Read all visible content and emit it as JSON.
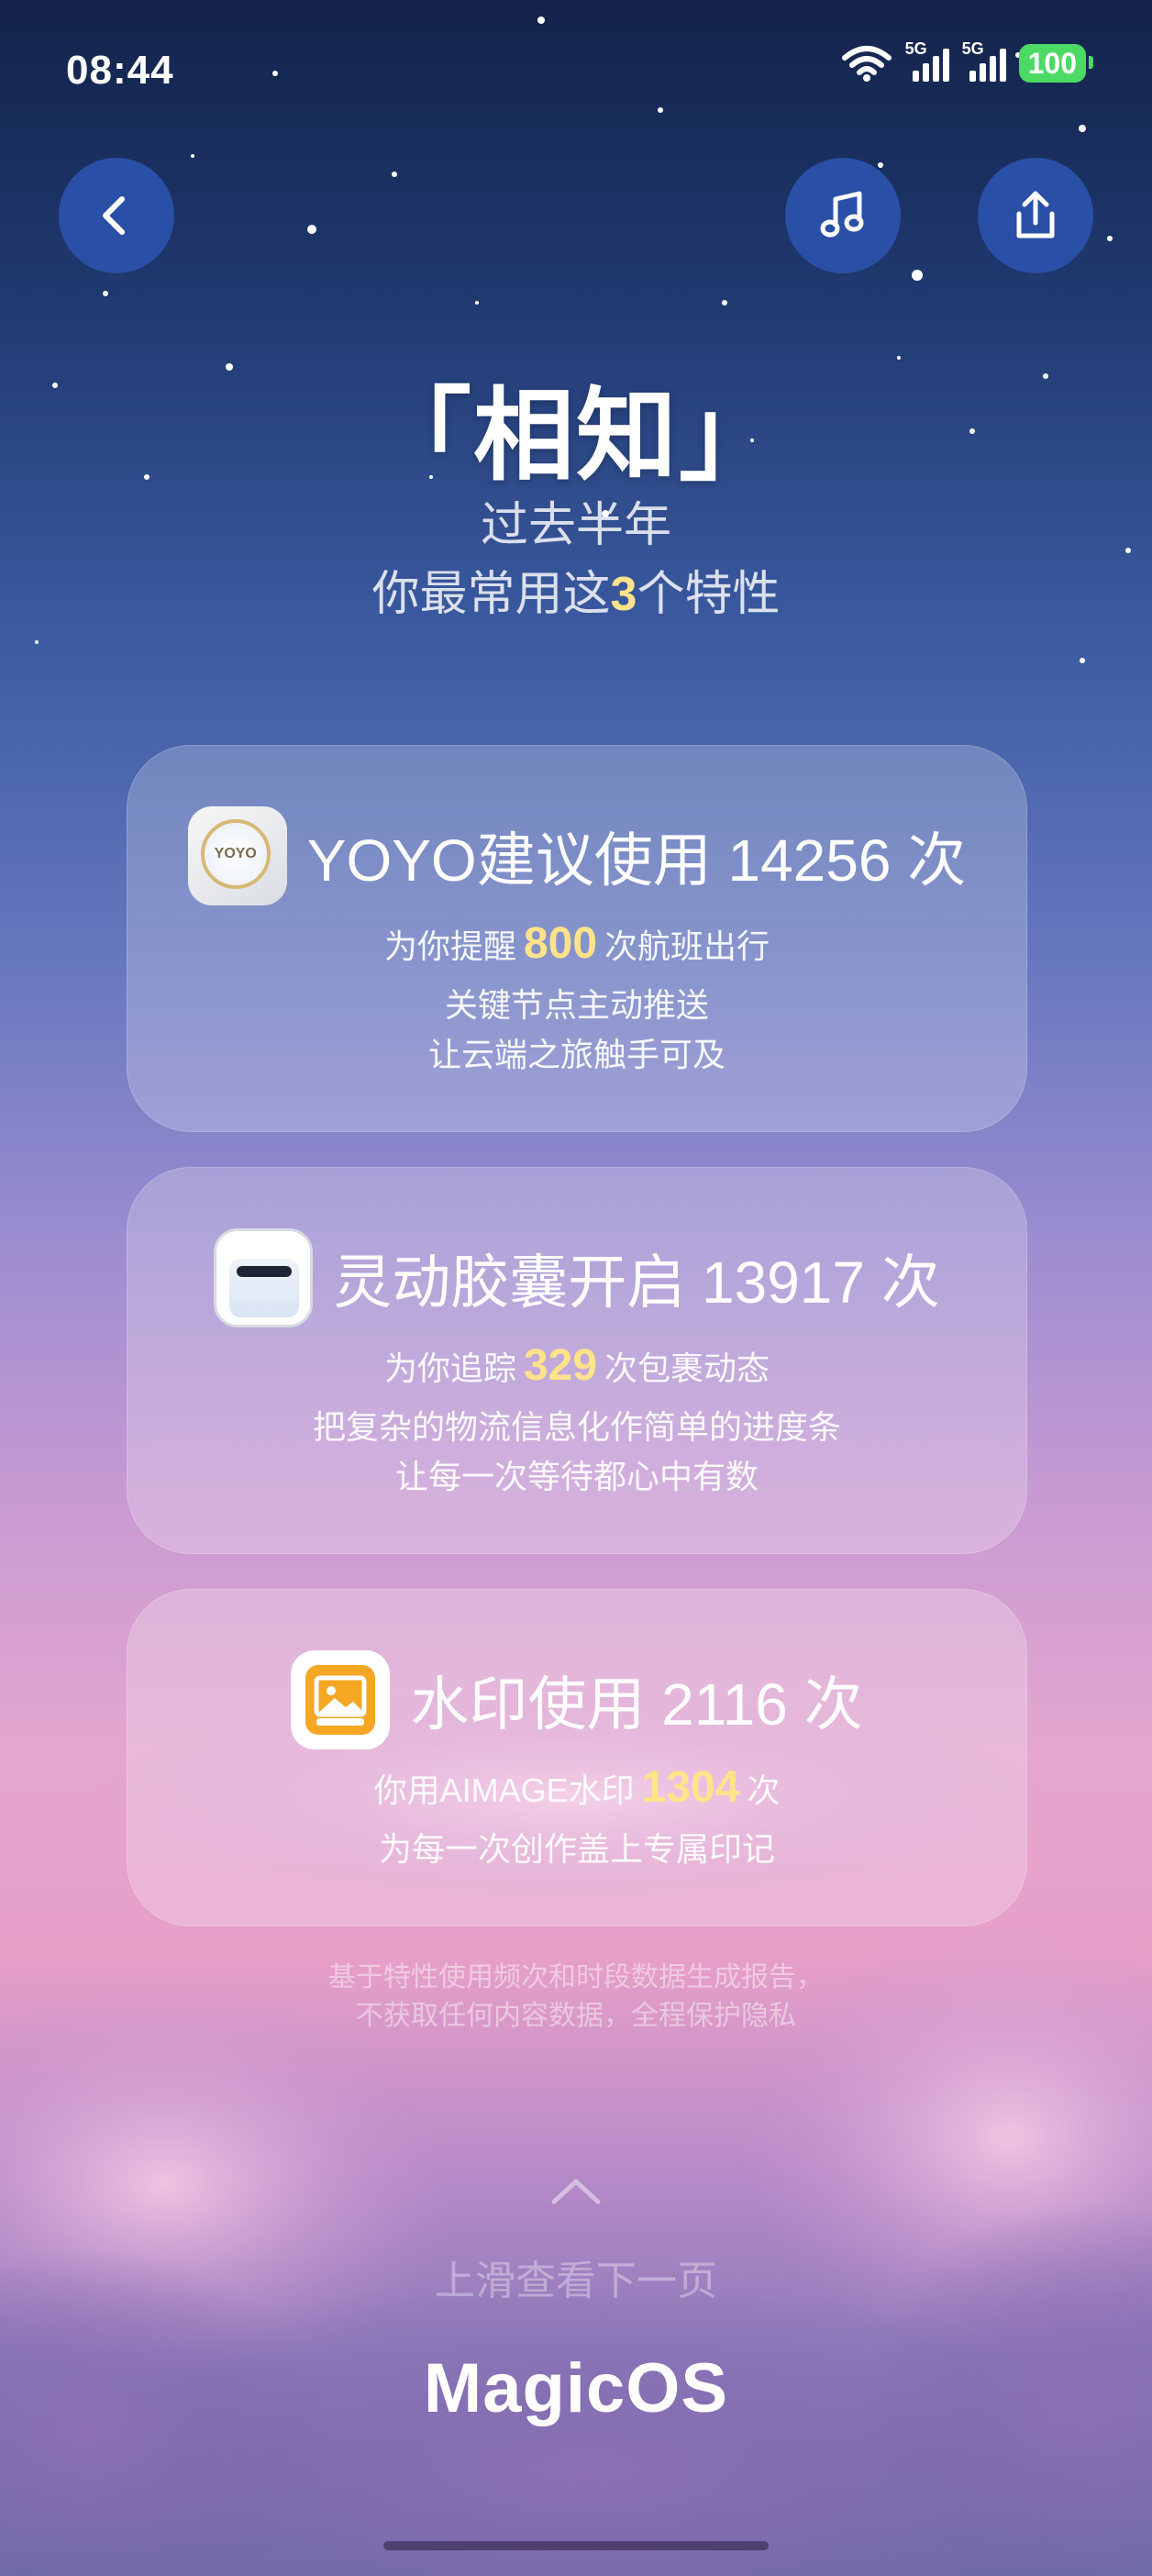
{
  "status_bar": {
    "time": "08:44",
    "sim1_tag": "5G",
    "sim2_tag": "5G",
    "battery": "100",
    "battery_color": "#4cd964"
  },
  "nav": {
    "back_icon": "chevron-left-icon",
    "music_icon": "music-note-icon",
    "share_icon": "share-icon"
  },
  "header": {
    "title": "「相知」",
    "subtitle_line1": "过去半年",
    "subtitle_line2_pre": "你最常用这",
    "subtitle_line2_num": "3",
    "subtitle_line2_post": "个特性"
  },
  "cards": [
    {
      "icon": "yoyo-icon",
      "icon_text": "YOYO",
      "title": "YOYO建议使用 14256 次",
      "line1_pre": "为你提醒",
      "line1_num": "800",
      "line1_post": "次航班出行",
      "line2": "关键节点主动推送",
      "line3": "让云端之旅触手可及"
    },
    {
      "icon": "dynamic-capsule-icon",
      "title": "灵动胶囊开启 13917 次",
      "line1_pre": "为你追踪",
      "line1_num": "329",
      "line1_post": "次包裹动态",
      "line2": "把复杂的物流信息化作简单的进度条",
      "line3": "让每一次等待都心中有数"
    },
    {
      "icon": "watermark-photo-icon",
      "title": "水印使用 2116 次",
      "line1_pre": "你用AIMAGE水印",
      "line1_num": "1304",
      "line1_post": "次",
      "line2": "为每一次创作盖上专属印记"
    }
  ],
  "footnote": {
    "line1": "基于特性使用频次和时段数据生成报告，",
    "line2": "不获取任何内容数据，全程保护隐私"
  },
  "swipe_hint": "上滑查看下一页",
  "brand": "MagicOS",
  "colors": {
    "accent_number": "#ffe38a",
    "nav_button": "#2a4fa6"
  }
}
